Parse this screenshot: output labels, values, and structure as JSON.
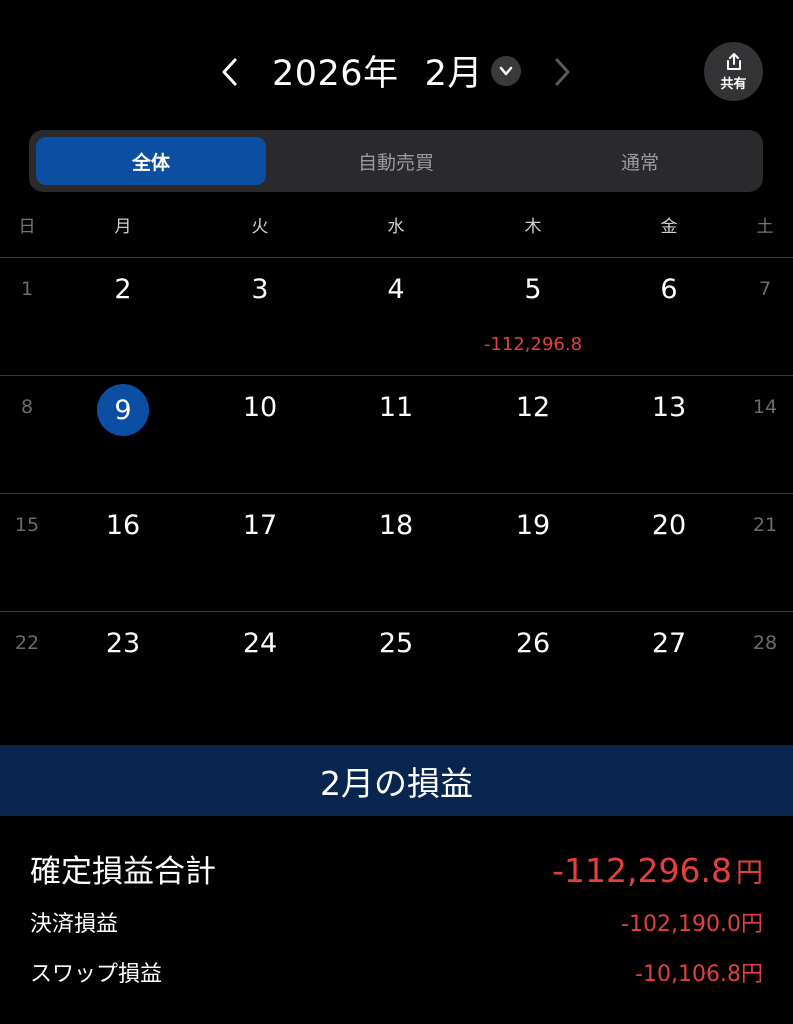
{
  "header": {
    "year": "2026年",
    "month": "2月",
    "share_label": "共有",
    "icons": {
      "prev": "chevron-left-icon",
      "next": "chevron-right-icon",
      "dropdown": "chevron-down-icon",
      "share": "share-icon"
    }
  },
  "tabs": [
    {
      "label": "全体",
      "active": true
    },
    {
      "label": "自動売買",
      "active": false
    },
    {
      "label": "通常",
      "active": false
    }
  ],
  "weekdays": [
    "日",
    "月",
    "火",
    "水",
    "木",
    "金",
    "土"
  ],
  "weeks": [
    {
      "days": [
        "1",
        "2",
        "3",
        "4",
        "5",
        "6",
        "7"
      ],
      "pl": {
        "thu": "-112,296.8"
      }
    },
    {
      "days": [
        "8",
        "9",
        "10",
        "11",
        "12",
        "13",
        "14"
      ]
    },
    {
      "days": [
        "15",
        "16",
        "17",
        "18",
        "19",
        "20",
        "21"
      ]
    },
    {
      "days": [
        "22",
        "23",
        "24",
        "25",
        "26",
        "27",
        "28"
      ]
    }
  ],
  "today": "9",
  "colors": {
    "accent": "#0b4ea2",
    "summary_bar": "#08254f",
    "loss": "#e0413d",
    "background": "#000000"
  },
  "summary": {
    "title": "2月の損益",
    "total_label": "確定損益合計",
    "total_value": "-112,296.8",
    "yen": "円",
    "settle_label": "決済損益",
    "settle_value": "-102,190.0円",
    "swap_label": "スワップ損益",
    "swap_value": "-10,106.8円"
  }
}
